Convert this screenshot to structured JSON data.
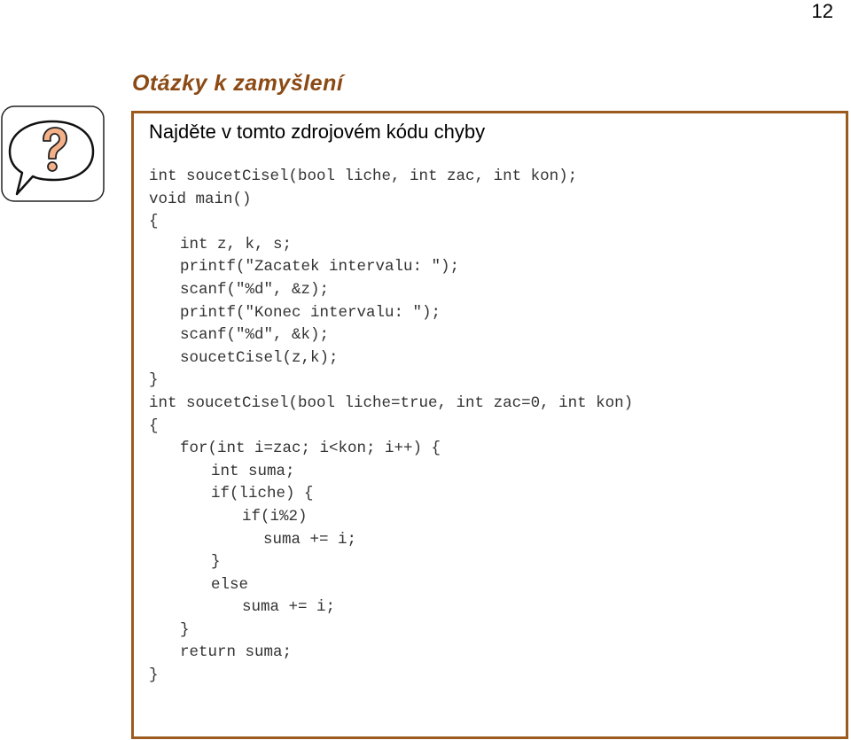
{
  "page": {
    "number": "12"
  },
  "section": {
    "title": "Otázky k zamyšlení",
    "icon": "question-speech-bubble-icon",
    "accent_color": "#8b4a14",
    "border_color": "#9b5a1e",
    "icon_fill_color": "#f4b088"
  },
  "question": {
    "prompt": "Najděte v tomto zdrojovém kódu chyby",
    "code_lines": [
      {
        "indent": 0,
        "text": "int soucetCisel(bool liche, int zac, int kon);"
      },
      {
        "indent": 0,
        "text": "void main()"
      },
      {
        "indent": 0,
        "text": "{"
      },
      {
        "indent": 1,
        "text": "int z, k, s;"
      },
      {
        "indent": 1,
        "text": "printf(\"Zacatek intervalu: \");"
      },
      {
        "indent": 1,
        "text": "scanf(\"%d\", &z);"
      },
      {
        "indent": 1,
        "text": "printf(\"Konec intervalu: \");"
      },
      {
        "indent": 1,
        "text": "scanf(\"%d\", &k);"
      },
      {
        "indent": 1,
        "text": "soucetCisel(z,k);"
      },
      {
        "indent": 0,
        "text": "}"
      },
      {
        "indent": 0,
        "text": "int soucetCisel(bool liche=true, int zac=0, int kon)"
      },
      {
        "indent": 0,
        "text": "{"
      },
      {
        "indent": 1,
        "text": "for(int i=zac; i<kon; i++) {"
      },
      {
        "indent": 2,
        "text": "int suma;"
      },
      {
        "indent": 2,
        "text": "if(liche) {"
      },
      {
        "indent": 3,
        "text": "if(i%2)"
      },
      {
        "indent": 4,
        "text": "suma += i;"
      },
      {
        "indent": 2,
        "text": "}"
      },
      {
        "indent": 2,
        "text": "else"
      },
      {
        "indent": 3,
        "text": "suma += i;"
      },
      {
        "indent": 1,
        "text": "}"
      },
      {
        "indent": 1,
        "text": "return suma;"
      },
      {
        "indent": 0,
        "text": "}"
      }
    ]
  }
}
